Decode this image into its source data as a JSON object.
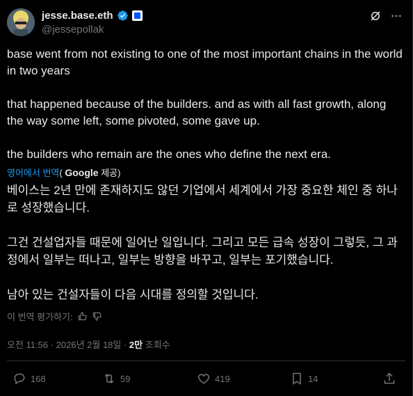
{
  "author": {
    "display_name": "jesse.base.eth",
    "handle": "@jessepollak"
  },
  "tweet": {
    "paragraphs": [
      "base went from not existing to one of the most important chains in the world in two years",
      "that happened because of the builders. and as with all fast growth, along the way some left, some pivoted, some gave up.",
      "the builders who remain are the ones who define the next era."
    ]
  },
  "translation": {
    "source_link": "영어에서 번역",
    "provider_prefix": "(",
    "provider": "Google",
    "provider_suffix": "제공)",
    "paragraphs": [
      "베이스는 2년 만에 존재하지도 않던 기업에서 세계에서 가장 중요한 체인 중 하나로 성장했습니다.",
      "그건 건설업자들 때문에 일어난 일입니다. 그리고 모든 급속 성장이 그렇듯, 그 과정에서 일부는 떠나고, 일부는 방향을 바꾸고, 일부는 포기했습니다.",
      "남아 있는 건설자들이 다음 시대를 정의할 것입니다."
    ],
    "rate_label": "이 번역 평가하기:"
  },
  "meta": {
    "timestamp": "오전 11:56 · 2026년 2월 18일 · ",
    "views_count": "2만",
    "views_label": " 조회수"
  },
  "actions": {
    "replies": "168",
    "reposts": "59",
    "likes": "419",
    "bookmarks": "14"
  },
  "icons": {
    "verified": "verified-badge-icon",
    "affiliate": "base-affiliate-icon",
    "grok": "grok-icon",
    "more": "more-icon",
    "reply": "reply-icon",
    "repost": "repost-icon",
    "like": "like-icon",
    "bookmark": "bookmark-icon",
    "share": "share-icon"
  },
  "colors": {
    "background": "#000000",
    "text": "#e7e9ea",
    "secondary": "#71767b",
    "link": "#1d9bf0",
    "verified": "#1d9bf0",
    "base_blue": "#0052ff"
  }
}
